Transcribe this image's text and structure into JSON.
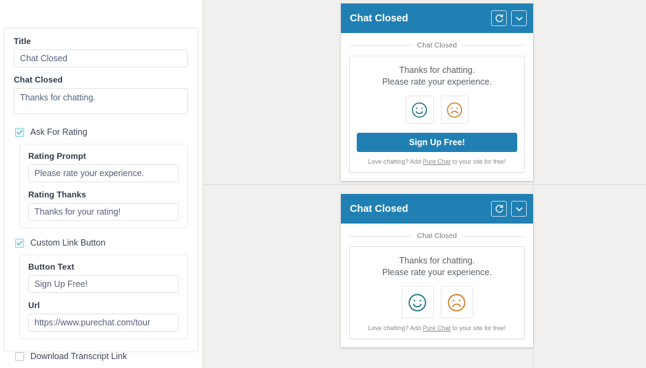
{
  "colors": {
    "brand_blue": "#2180b3",
    "page_bg": "#f1f0ee",
    "happy_teal": "#12707c",
    "sad_orange": "#d2791e",
    "checkbox_teal": "#3fb0bd"
  },
  "settings": {
    "title_label": "Title",
    "title_value": "Chat Closed",
    "message_label": "Chat Closed",
    "message_value": "Thanks for chatting.",
    "ask_for_rating": {
      "label": "Ask For Rating",
      "checked": true,
      "icon": "checkbox-checked-icon",
      "rating_prompt_label": "Rating Prompt",
      "rating_prompt_value": "Please rate your experience.",
      "rating_thanks_label": "Rating Thanks",
      "rating_thanks_value": "Thanks for your rating!"
    },
    "custom_link_button": {
      "label": "Custom Link Button",
      "checked": true,
      "icon": "checkbox-checked-icon",
      "button_text_label": "Button Text",
      "button_text_value": "Sign Up Free!",
      "url_label": "Url",
      "url_value": "https://www.purechat.com/tour"
    },
    "download_transcript": {
      "label": "Download Transcript Link",
      "checked": false,
      "icon": "checkbox-unchecked-icon"
    }
  },
  "preview_top": {
    "header_title": "Chat Closed",
    "refresh_icon": "refresh-icon",
    "collapse_icon": "chevron-down-icon",
    "divider_label": "Chat Closed",
    "message_line_1": "Thanks for chatting.",
    "message_line_2": "Please rate your experience.",
    "happy_icon": "happy-face-icon",
    "sad_icon": "sad-face-icon",
    "cta_label": "Sign Up Free!",
    "footer_prefix": "Love chatting? Add ",
    "footer_link": "Pure Chat",
    "footer_suffix": " to your site for free!"
  },
  "preview_bottom": {
    "header_title": "Chat Closed",
    "refresh_icon": "refresh-icon",
    "collapse_icon": "chevron-down-icon",
    "divider_label": "Chat Closed",
    "message_line_1": "Thanks for chatting.",
    "message_line_2": "Please rate your experience.",
    "happy_icon": "happy-face-icon",
    "sad_icon": "sad-face-icon",
    "footer_prefix": "Love chatting? Add ",
    "footer_link": "Pure Chat",
    "footer_suffix": " to your site for free!"
  }
}
